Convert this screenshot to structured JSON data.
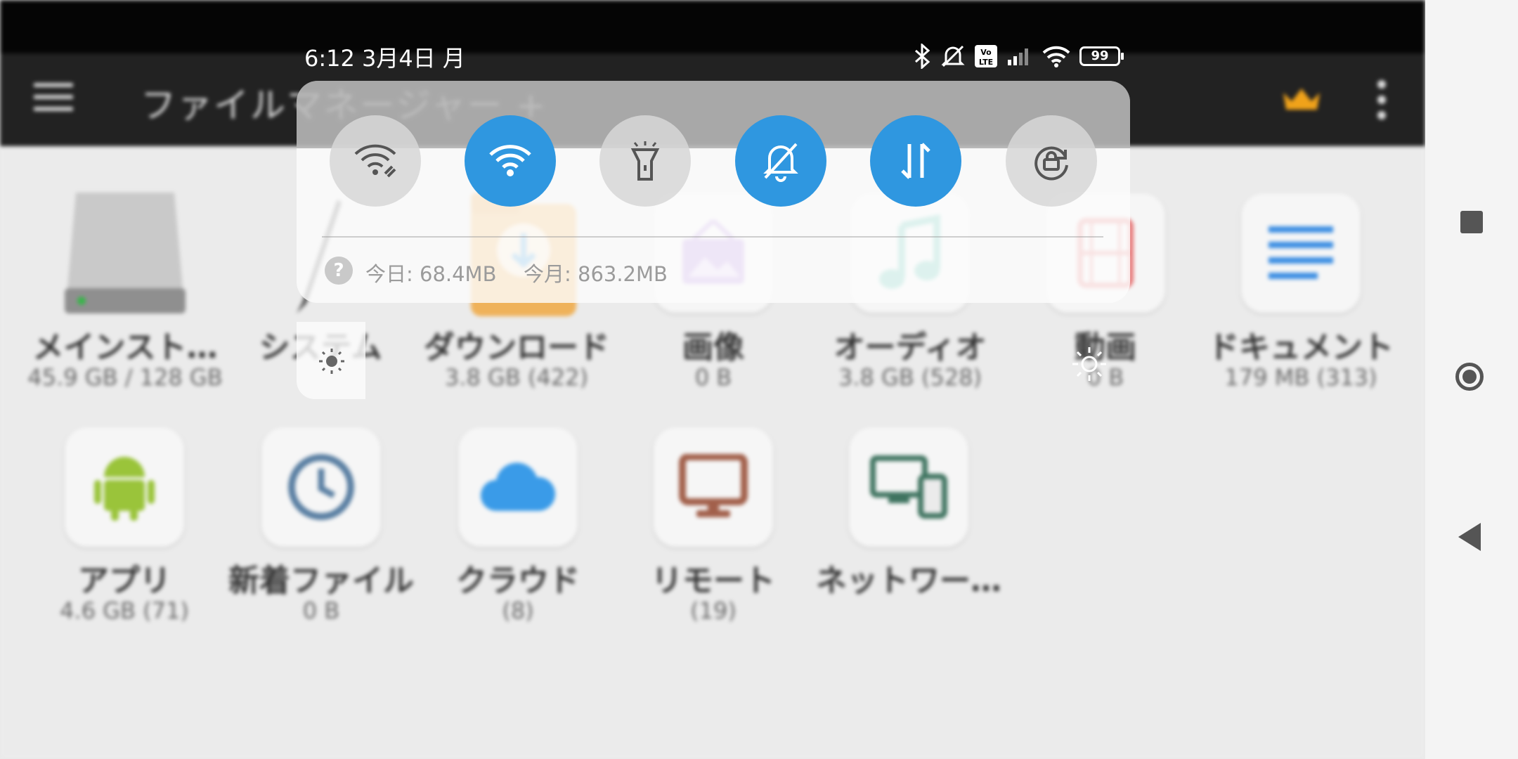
{
  "status_bar": {
    "time": "6:12 3月4日 月",
    "battery": "99"
  },
  "app": {
    "title": "ファイルマネージャー +",
    "icons": {
      "menu": "hamburger-menu-icon",
      "premium": "crown-icon",
      "more": "more-vert-icon"
    },
    "categories": [
      {
        "id": "main-storage",
        "label": "メインスト…",
        "sub": "45.9 GB / 128 GB",
        "icon": "hard-drive-icon"
      },
      {
        "id": "system",
        "label": "システム",
        "sub": "",
        "icon": "pen-icon"
      },
      {
        "id": "downloads",
        "label": "ダウンロード",
        "sub": "3.8 GB (422)",
        "icon": "download-folder-icon"
      },
      {
        "id": "images",
        "label": "画像",
        "sub": "0 B",
        "icon": "picture-frame-icon"
      },
      {
        "id": "audio",
        "label": "オーディオ",
        "sub": "3.8 GB (528)",
        "icon": "music-note-icon"
      },
      {
        "id": "videos",
        "label": "動画",
        "sub": "0 B",
        "icon": "film-icon"
      },
      {
        "id": "documents",
        "label": "ドキュメント",
        "sub": "179 MB (313)",
        "icon": "document-lines-icon"
      },
      {
        "id": "apps",
        "label": "アプリ",
        "sub": "4.6 GB (71)",
        "icon": "android-icon"
      },
      {
        "id": "recent",
        "label": "新着ファイル",
        "sub": "0 B",
        "icon": "clock-icon"
      },
      {
        "id": "cloud",
        "label": "クラウド",
        "sub": "(8)",
        "icon": "cloud-icon"
      },
      {
        "id": "remote",
        "label": "リモート",
        "sub": "(19)",
        "icon": "monitor-icon"
      },
      {
        "id": "network",
        "label": "ネットワー…",
        "sub": "",
        "icon": "devices-icon"
      }
    ]
  },
  "quick_settings": {
    "toggles": [
      {
        "name": "wifi-share",
        "icon": "wifi-link-icon",
        "active": false
      },
      {
        "name": "wifi",
        "icon": "wifi-icon",
        "active": true
      },
      {
        "name": "flashlight",
        "icon": "flashlight-icon",
        "active": false
      },
      {
        "name": "silent",
        "icon": "bell-off-icon",
        "active": true
      },
      {
        "name": "mobile-data",
        "icon": "data-arrows-icon",
        "active": true
      },
      {
        "name": "rotation-lock",
        "icon": "rotation-lock-icon",
        "active": false
      }
    ],
    "data_today": "今日: 68.4MB",
    "data_month": "今月: 863.2MB",
    "help_glyph": "?"
  },
  "colors": {
    "active_toggle": "#2f97e0",
    "premium": "#f0a21a"
  },
  "nav": {
    "recent": "recent-apps-icon",
    "home": "home-icon",
    "back": "back-icon"
  }
}
